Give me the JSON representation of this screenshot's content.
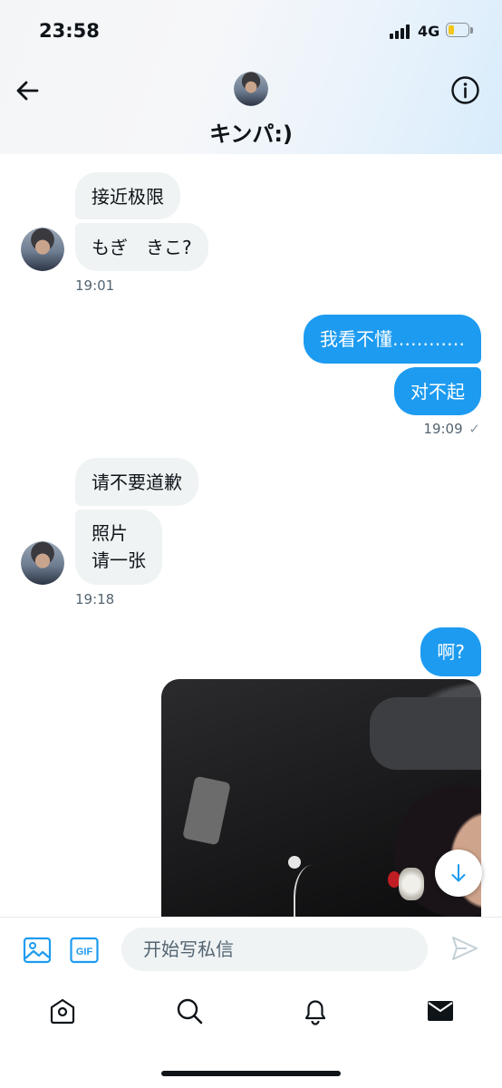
{
  "status_bar": {
    "time": "23:58",
    "network": "4G",
    "battery_color": "#f5c518"
  },
  "header": {
    "name": "キンパ:)",
    "back_icon": "arrow-left-icon",
    "info_icon": "info-icon"
  },
  "messages": [
    {
      "id": "m1",
      "direction": "incoming",
      "text": "接近极限"
    },
    {
      "id": "m2",
      "direction": "incoming",
      "text": "もぎ　きこ?"
    },
    {
      "id": "m3",
      "direction": "outgoing",
      "text": "我看不懂…………"
    },
    {
      "id": "m4",
      "direction": "outgoing",
      "text": "对不起"
    },
    {
      "id": "m5",
      "direction": "incoming",
      "text": "请不要道歉"
    },
    {
      "id": "m6",
      "direction": "incoming",
      "text_line1": "照片",
      "text_line2": "请一张"
    },
    {
      "id": "m7",
      "direction": "outgoing",
      "text": "啊?"
    },
    {
      "id": "m8",
      "direction": "outgoing",
      "type": "photo"
    }
  ],
  "timestamps": {
    "t1": "19:01",
    "t2": "19:09",
    "t2_status": "✓",
    "t3": "19:18"
  },
  "composer": {
    "placeholder": "开始写私信",
    "gif_label": "GIF"
  },
  "tabbar": {
    "items": [
      "home-icon",
      "search-icon",
      "bell-icon",
      "mail-icon"
    ],
    "active": "mail-icon"
  },
  "colors": {
    "accent": "#1d9bf0",
    "incoming_bubble": "#eff3f4",
    "text": "#0f1419",
    "muted": "#536471"
  }
}
